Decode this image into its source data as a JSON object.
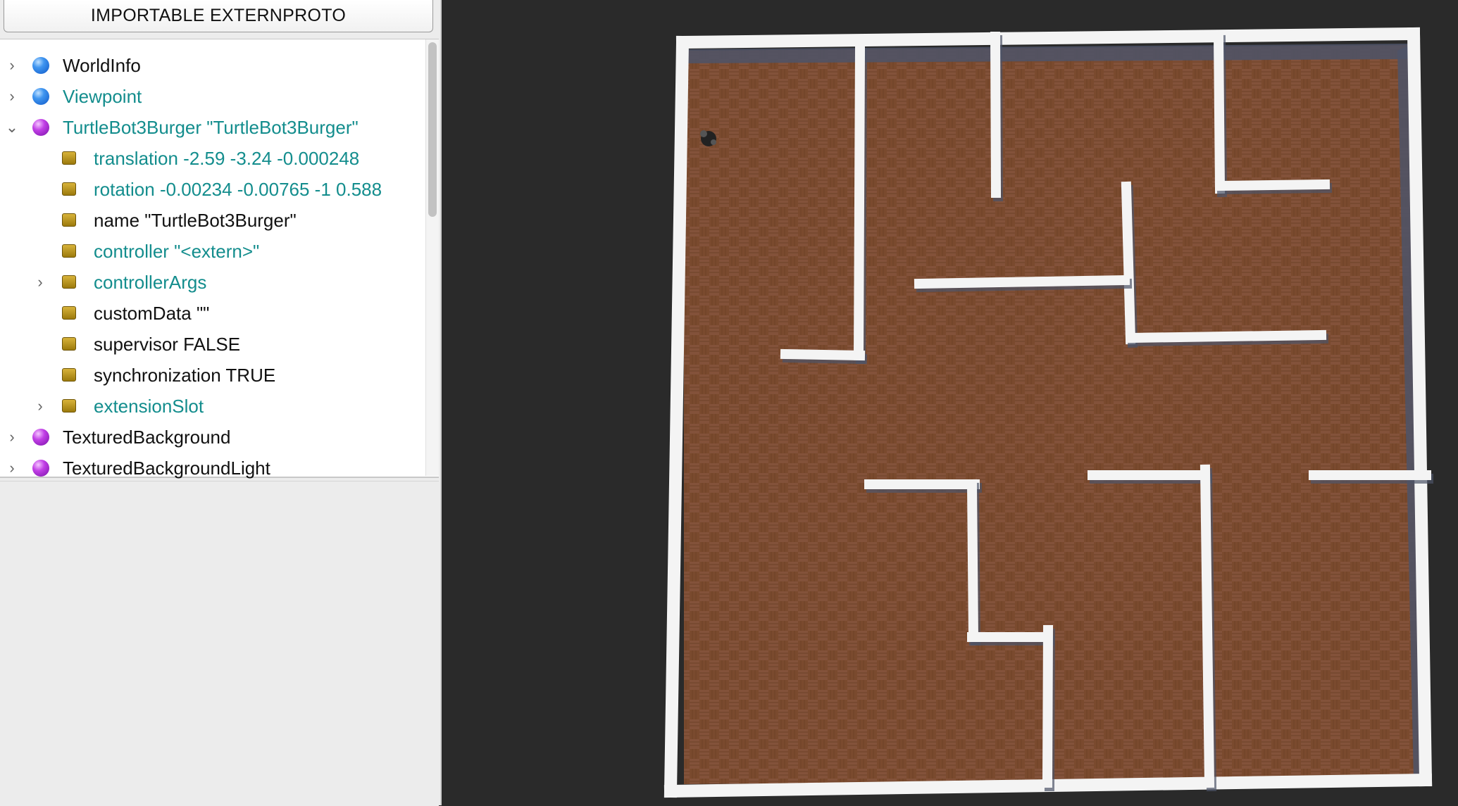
{
  "toolbar": {
    "import_button": "IMPORTABLE EXTERNPROTO"
  },
  "tree": {
    "rows": [
      {
        "label": "WorldInfo",
        "icon": "blue-sphere-icon",
        "expander": "›",
        "teal": false
      },
      {
        "label": "Viewpoint",
        "icon": "blue-sphere-icon",
        "expander": "›",
        "teal": true
      },
      {
        "label": "TurtleBot3Burger \"TurtleBot3Burger\"",
        "icon": "purple-sphere-icon",
        "expander": "⌄",
        "teal": true
      },
      {
        "label": "translation -2.59 -3.24 -0.000248",
        "icon": "field-icon",
        "expander": "",
        "teal": true
      },
      {
        "label": "rotation -0.00234 -0.00765 -1 0.588",
        "icon": "field-icon",
        "expander": "",
        "teal": true
      },
      {
        "label": "name \"TurtleBot3Burger\"",
        "icon": "field-icon",
        "expander": "",
        "teal": false
      },
      {
        "label": "controller \"<extern>\"",
        "icon": "field-icon",
        "expander": "",
        "teal": true
      },
      {
        "label": "controllerArgs",
        "icon": "field-icon",
        "expander": "›",
        "teal": true
      },
      {
        "label": "customData \"\"",
        "icon": "field-icon",
        "expander": "",
        "teal": false
      },
      {
        "label": "supervisor FALSE",
        "icon": "field-icon",
        "expander": "",
        "teal": false
      },
      {
        "label": "synchronization TRUE",
        "icon": "field-icon",
        "expander": "",
        "teal": false
      },
      {
        "label": "extensionSlot",
        "icon": "field-icon",
        "expander": "›",
        "teal": true
      },
      {
        "label": "TexturedBackground",
        "icon": "purple-sphere-icon",
        "expander": "›",
        "teal": false
      },
      {
        "label": "TexturedBackgroundLight",
        "icon": "purple-sphere-icon",
        "expander": "›",
        "teal": false
      }
    ]
  },
  "viewport": {
    "floor_color": "#7a4a2e",
    "wall_color": "#f4f4f4",
    "wall_shadow_color": "#4d5468",
    "robot_color": "#222222"
  }
}
